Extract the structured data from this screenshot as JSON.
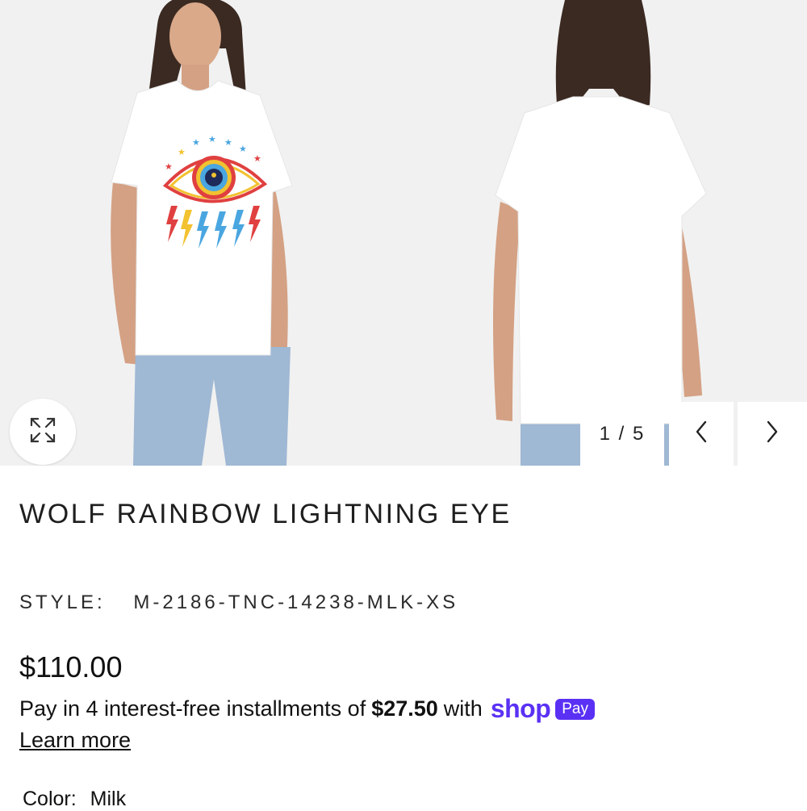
{
  "gallery": {
    "counter": "1 / 5",
    "icons": {
      "expand": "expand-arrows-icon",
      "prev": "chevron-left-icon",
      "next": "chevron-right-icon"
    }
  },
  "product": {
    "title": "WOLF RAINBOW LIGHTNING EYE",
    "style_label": "STYLE:",
    "style_value": "M-2186-TNC-14238-MLK-XS",
    "price": "$110.00",
    "installments": {
      "prefix": "Pay in 4 interest-free installments of",
      "amount": "$27.50",
      "suffix": "with",
      "brand": "shop",
      "badge": "Pay"
    },
    "learn_more": "Learn more",
    "color_label": "Color:",
    "color_value": "Milk"
  },
  "colors": {
    "brand_purple": "#5a31f4",
    "background": "#f1f1f1",
    "text": "#1a1a1a"
  }
}
